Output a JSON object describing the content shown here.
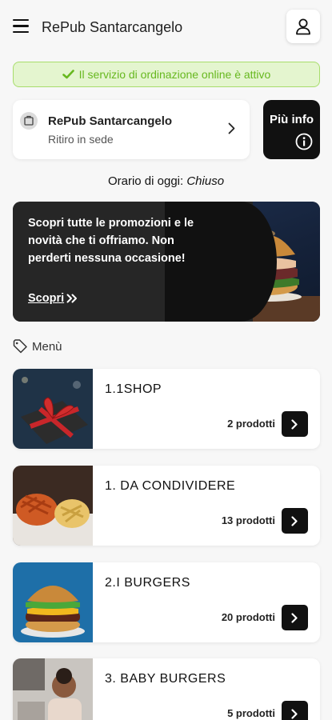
{
  "header": {
    "title": "RePub Santarcangelo"
  },
  "status": {
    "text": "Il servizio di ordinazione online è attivo",
    "color": "#67b81f"
  },
  "store": {
    "name": "RePub Santarcangelo",
    "mode": "Ritiro in sede",
    "info_label": "Più info"
  },
  "hours": {
    "label": "Orario di oggi:",
    "value": "Chiuso"
  },
  "promo": {
    "text": "Scopri tutte le promozioni e le novità che ti offriamo. Non perderti nessuna occasione!",
    "link": "Scopri"
  },
  "menu": {
    "heading": "Menù",
    "categories": [
      {
        "title": "1.1SHOP",
        "count": "2 prodotti"
      },
      {
        "title": "1. DA CONDIVIDERE",
        "count": "13 prodotti"
      },
      {
        "title": "2.I BURGERS",
        "count": "20 prodotti"
      },
      {
        "title": "3. BABY BURGERS",
        "count": "5 prodotti"
      }
    ]
  },
  "icons": [
    "menu-icon",
    "user-icon",
    "check-icon",
    "store-icon",
    "chevron-right-icon",
    "info-icon",
    "double-chevron-icon",
    "tag-icon"
  ]
}
